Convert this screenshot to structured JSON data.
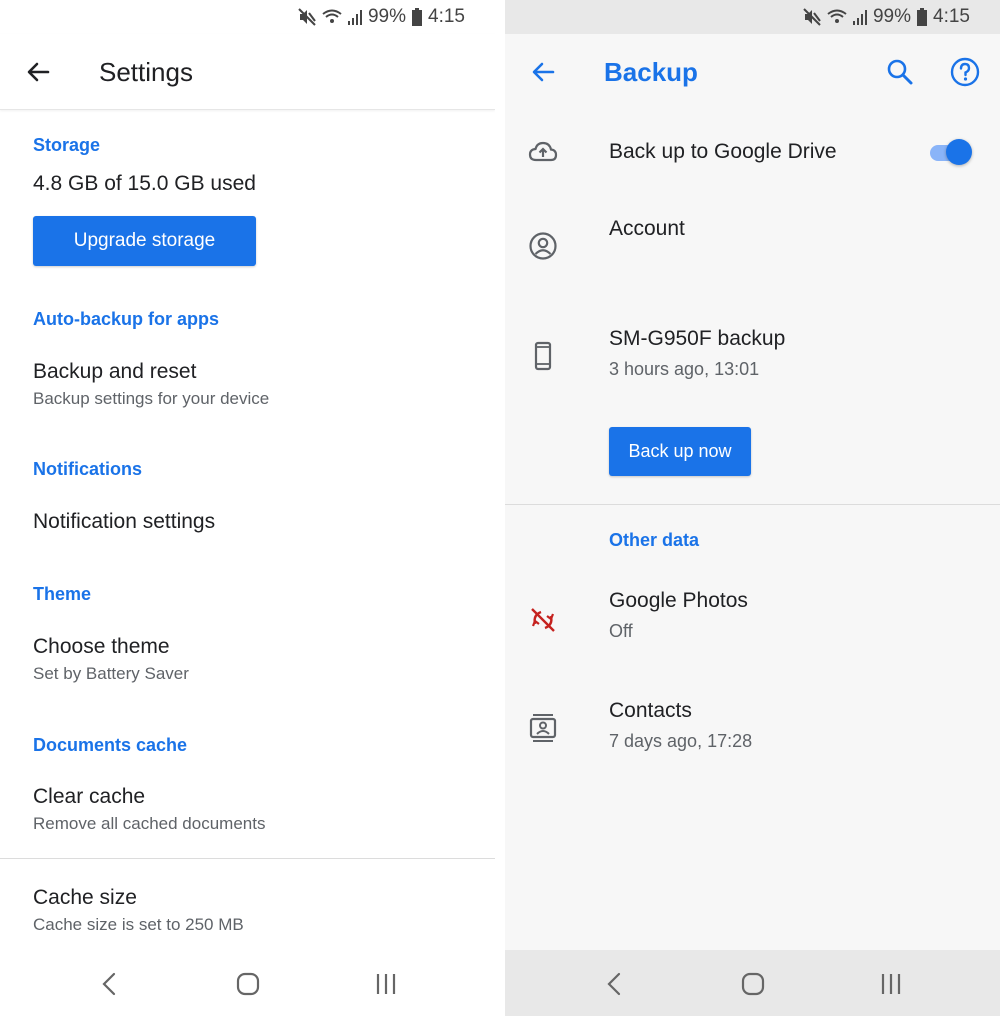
{
  "status_bar": {
    "battery": "99%",
    "time": "4:15"
  },
  "settings": {
    "title": "Settings",
    "storage": {
      "header": "Storage",
      "usage": "4.8 GB of 15.0 GB used",
      "button": "Upgrade storage"
    },
    "auto_backup": {
      "header": "Auto-backup for apps",
      "title": "Backup and reset",
      "subtitle": "Backup settings for your device"
    },
    "notifications": {
      "header": "Notifications",
      "title": "Notification settings"
    },
    "theme": {
      "header": "Theme",
      "title": "Choose theme",
      "subtitle": "Set by Battery Saver"
    },
    "documents_cache": {
      "header": "Documents cache",
      "title": "Clear cache",
      "subtitle": "Remove all cached documents"
    },
    "cache_size": {
      "title": "Cache size",
      "subtitle": "Cache size is set to 250 MB"
    }
  },
  "backup": {
    "title": "Backup",
    "drive_toggle": {
      "label": "Back up to Google Drive",
      "enabled": true
    },
    "account": {
      "label": "Account"
    },
    "device": {
      "name": "SM-G950F backup",
      "time": "3 hours ago, 13:01",
      "button": "Back up now"
    },
    "other_data": {
      "header": "Other data",
      "google_photos": {
        "label": "Google Photos",
        "status": "Off"
      },
      "contacts": {
        "label": "Contacts",
        "time": "7 days ago, 17:28"
      }
    }
  },
  "colors": {
    "accent": "#1a73e8",
    "photos_off": "#c5221f",
    "toggle_track": "#8ab4f8"
  },
  "icons": [
    "mute-icon",
    "wifi-icon",
    "signal-icon",
    "battery-icon",
    "back-arrow-icon",
    "search-icon",
    "help-icon",
    "cloud-upload-icon",
    "account-circle-icon",
    "phone-icon",
    "sync-off-icon",
    "contacts-icon",
    "nav-back-icon",
    "nav-home-icon",
    "nav-recents-icon"
  ]
}
